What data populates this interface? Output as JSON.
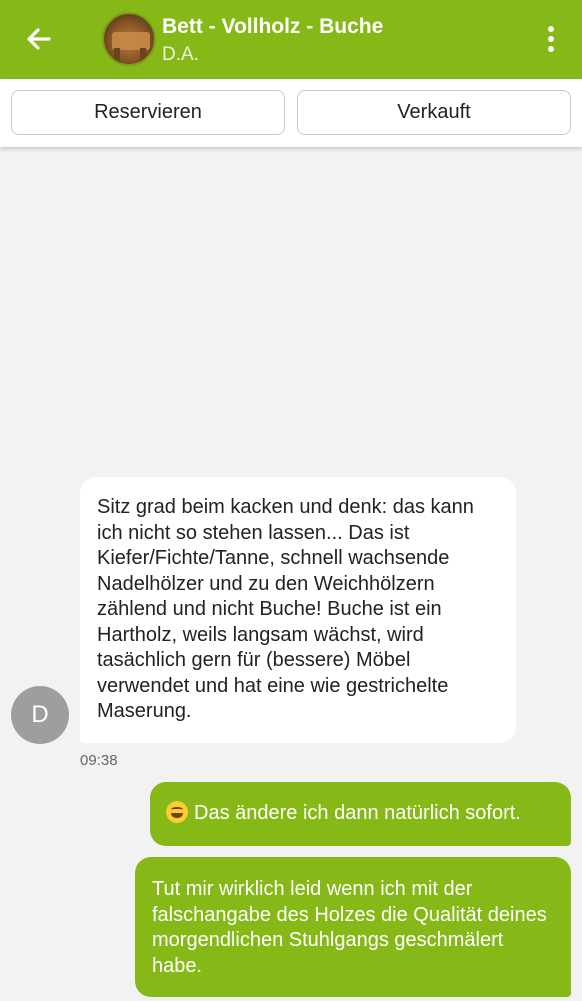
{
  "header": {
    "title": "Bett - Vollholz - Buche",
    "subtitle": "D.A.",
    "back_icon": "arrow-left-icon",
    "menu_icon": "more-vert-icon",
    "accent_color": "#86b817"
  },
  "actions": {
    "reserve_label": "Reservieren",
    "sold_label": "Verkauft"
  },
  "messages": [
    {
      "direction": "incoming",
      "sender_initial": "D",
      "text": "Sitz grad beim kacken und denk: das kann ich nicht so stehen lassen... Das ist Kiefer/Fichte/Tanne, schnell wachsende Nadelhölzer und zu den Weichhölzern zählend und nicht Buche! Buche ist ein Hartholz, weils langsam wächst, wird tasächlich gern für (bessere) Möbel verwendet und hat eine wie gestrichelte Maserung.",
      "time": "09:38"
    },
    {
      "direction": "outgoing",
      "emoji": "grinning-sweat-emoji",
      "text": "Das ändere ich dann natürlich sofort."
    },
    {
      "direction": "outgoing",
      "text": "Tut mir wirklich leid wenn ich mit der falschangabe des Holzes die Qualität deines morgendlichen Stuhlgangs geschmälert  habe."
    }
  ]
}
